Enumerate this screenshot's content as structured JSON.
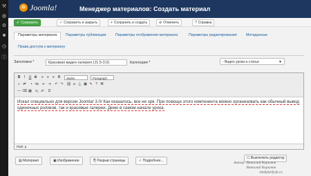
{
  "brand": {
    "logo_text": "Joomla!"
  },
  "header": {
    "title": "Менеджер материалов: Создать материал"
  },
  "left_rail": {
    "icons": [
      "wrench-icon",
      "globe-icon",
      "gear-icon",
      "user-icon",
      "clock-icon",
      "info-icon"
    ]
  },
  "toolbar": {
    "save": "Сохранить",
    "save_close": "Сохранить и закрыть",
    "save_new": "Сохранить и создать",
    "cancel": "Отменить",
    "help": "Справка"
  },
  "tabs": [
    "Параметры материала",
    "Параметры публикации",
    "Параметры отображения материала",
    "Параметры редактирования",
    "Метаданные",
    "Права доступа к материалу"
  ],
  "form": {
    "title_label": "Заголовок *",
    "title_value": "Красивая видео-галерея (J1.5-3.0)",
    "category_label": "Категория *",
    "category_value": "- Видео уроки и статьи"
  },
  "editor": {
    "styles_select": "Styles",
    "paragraph_select": "Paragraph",
    "content": "Искал специально для версии Joomla! 3.0/ Как оказалось, все не зря. При помощи этого компонента можно организовать как обычный вывод одиночных роликов, так и красивые галереи. Демо в самом начале урока.",
    "path": "Path: p",
    "toggle_editor": "Выключить редактор"
  },
  "bottom_buttons": [
    "Материал",
    "Изображение",
    "Разрыв страницы",
    "Подробнее..."
  ],
  "watermark": {
    "line1": "Автор: Виталий Кирилюк",
    "line2": "Виталий Кирилюк",
    "site": "vitaliykirilyuk.ru"
  }
}
